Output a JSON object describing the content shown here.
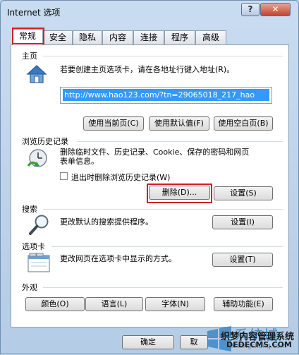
{
  "window": {
    "title": "Internet 选项",
    "help": "?",
    "close": "✕"
  },
  "tabs": [
    "常规",
    "安全",
    "隐私",
    "内容",
    "连接",
    "程序",
    "高级"
  ],
  "homepage": {
    "label": "主页",
    "description": "若要创建主页选项卡，请在各地址行键入地址(R)。",
    "url": "http://www.hao123.com/?tn=29065018_217_hao",
    "buttons": [
      "使用当前页(C)",
      "使用默认值(F)",
      "使用空白页(B)"
    ]
  },
  "history": {
    "label": "浏览历史记录",
    "description_line1": "删除临时文件、历史记录、Cookie、保存的密码和网页",
    "description_line2": "表单信息。",
    "checkbox_label": "退出时删除浏览历史记录(W)",
    "checkbox_checked": false,
    "delete_button": "删除(D)...",
    "settings_button": "设置(S)"
  },
  "search": {
    "label": "搜索",
    "description": "更改默认的搜索提供程序。",
    "settings_button": "设置(I)"
  },
  "tabs_section": {
    "label": "选项卡",
    "description": "更改网页在选项卡中显示的方式。",
    "settings_button": "设置(T)"
  },
  "appearance": {
    "label": "外观",
    "buttons": [
      "颜色(O)",
      "语言(L)",
      "字体(N)",
      "辅助功能(E)"
    ]
  },
  "footer": {
    "ok_button": "确定",
    "cancel_partial": "取"
  },
  "watermark": {
    "brand": "系统城",
    "site_name": "织梦内容管理系统",
    "site_url": "DEDECMS.COM",
    "domain": "xitongcheng.com"
  },
  "colors": {
    "highlight": "#cc2229",
    "selection": "#3399ff"
  }
}
